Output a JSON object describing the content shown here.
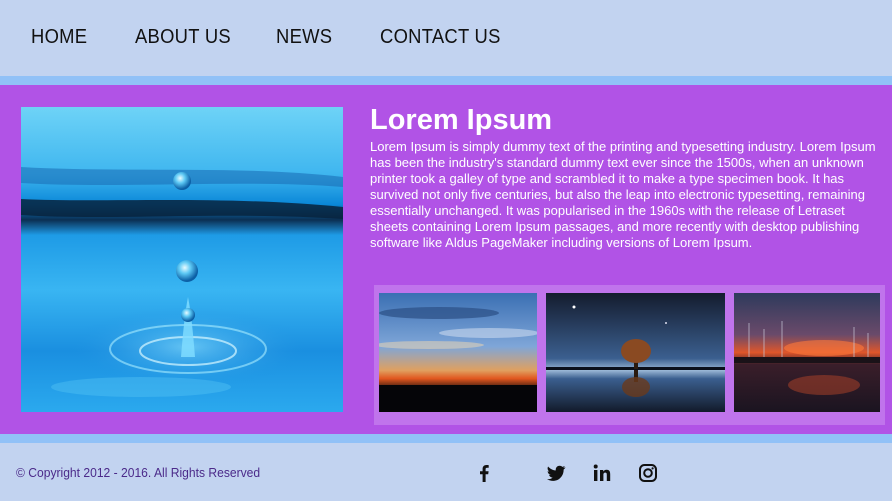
{
  "nav": {
    "items": [
      {
        "label": "HOME"
      },
      {
        "label": "ABOUT US"
      },
      {
        "label": "NEWS"
      },
      {
        "label": "CONTACT US"
      }
    ]
  },
  "content": {
    "title": "Lorem Ipsum",
    "paragraph": "Lorem Ipsum is simply dummy text of the printing and typesetting industry. Lorem Ipsum has been the industry's standard dummy text ever since the 1500s, when an unknown printer took a galley of type and scrambled it to make a type specimen book. It has survived not only five centuries, but also the leap into electronic typesetting, remaining essentially unchanged. It was popularised in the 1960s with the release of Letraset sheets containing Lorem Ipsum passages, and more recently with desktop publishing software like Aldus PageMaker including versions of Lorem Ipsum.",
    "hero_image": "water-drop-image",
    "gallery": [
      {
        "image": "sunset-clouds-image"
      },
      {
        "image": "tree-reflection-night-image"
      },
      {
        "image": "harbor-sunset-image"
      }
    ]
  },
  "footer": {
    "copyright": "© Copyright 2012 - 2016. All Rights Reserved",
    "social": [
      {
        "icon": "facebook-icon"
      },
      {
        "icon": "twitter-icon"
      },
      {
        "icon": "linkedin-icon"
      },
      {
        "icon": "instagram-icon"
      }
    ]
  },
  "colors": {
    "background": "#c2d3f0",
    "band": "#91c1f7",
    "accent": "#b153e6",
    "copyright_text": "#4b2a8a"
  }
}
